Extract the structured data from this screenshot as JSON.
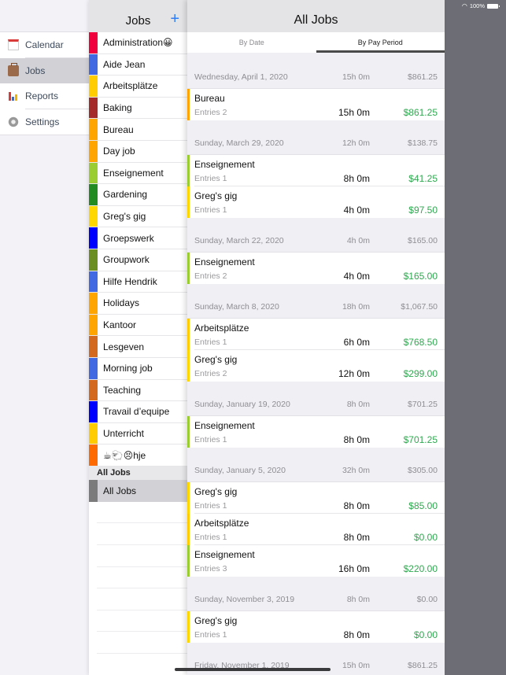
{
  "status_bar": {
    "battery": "100%",
    "wifi_icon": "wifi-icon",
    "battery_icon": "battery-icon"
  },
  "sidebar": {
    "items": [
      {
        "label": "Calendar",
        "icon": "calendar-icon",
        "selected": false
      },
      {
        "label": "Jobs",
        "icon": "briefcase-icon",
        "selected": true
      },
      {
        "label": "Reports",
        "icon": "bar-chart-icon",
        "selected": false
      },
      {
        "label": "Settings",
        "icon": "gear-icon",
        "selected": false
      }
    ]
  },
  "jobs_panel": {
    "title": "Jobs",
    "add_icon": "+",
    "jobs": [
      {
        "name": "Administration😀",
        "color": "#f0003c"
      },
      {
        "name": "Aide Jean",
        "color": "#4169e1"
      },
      {
        "name": "Arbeitsplätze",
        "color": "#ffcc00"
      },
      {
        "name": "Baking",
        "color": "#a52a2a"
      },
      {
        "name": "Bureau",
        "color": "#ffa500"
      },
      {
        "name": "Day job",
        "color": "#ffa500"
      },
      {
        "name": "Enseignement",
        "color": "#9acd32"
      },
      {
        "name": "Gardening",
        "color": "#228b22"
      },
      {
        "name": "Greg's gig",
        "color": "#ffd700"
      },
      {
        "name": "Groepswerk",
        "color": "#0000ff"
      },
      {
        "name": "Groupwork",
        "color": "#6b8e23"
      },
      {
        "name": "Hilfe Hendrik",
        "color": "#4169e1"
      },
      {
        "name": "Holidays",
        "color": "#ffa500"
      },
      {
        "name": "Kantoor",
        "color": "#ffa500"
      },
      {
        "name": "Lesgeven",
        "color": "#d2691e"
      },
      {
        "name": "Morning job",
        "color": "#4169e1"
      },
      {
        "name": "Teaching",
        "color": "#d2691e"
      },
      {
        "name": "Travail d’equipe",
        "color": "#0000ff"
      },
      {
        "name": "Unterricht",
        "color": "#ffcc00"
      },
      {
        "name": "☕🐑😣hje",
        "color": "#ff6a00"
      }
    ],
    "section_header": "All Jobs",
    "all_jobs_label": "All Jobs",
    "all_jobs_color": "#7b7b7b"
  },
  "main": {
    "title": "All Jobs",
    "tabs": [
      {
        "label": "By Date",
        "active": false
      },
      {
        "label": "By Pay Period",
        "active": true
      }
    ],
    "groups": [
      {
        "date": "Wednesday, April 1, 2020",
        "hours": "15h 0m",
        "amount": "$861.25",
        "entries": [
          {
            "job": "Bureau",
            "entries": "Entries 2",
            "hours": "15h 0m",
            "amount": "$861.25",
            "color": "#ffa500"
          }
        ]
      },
      {
        "date": "Sunday, March 29, 2020",
        "hours": "12h 0m",
        "amount": "$138.75",
        "entries": [
          {
            "job": "Enseignement",
            "entries": "Entries 1",
            "hours": "8h 0m",
            "amount": "$41.25",
            "color": "#9acd32"
          },
          {
            "job": "Greg's gig",
            "entries": "Entries 1",
            "hours": "4h 0m",
            "amount": "$97.50",
            "color": "#ffd700"
          }
        ]
      },
      {
        "date": "Sunday, March 22, 2020",
        "hours": "4h 0m",
        "amount": "$165.00",
        "entries": [
          {
            "job": "Enseignement",
            "entries": "Entries 2",
            "hours": "4h 0m",
            "amount": "$165.00",
            "color": "#9acd32"
          }
        ]
      },
      {
        "date": "Sunday, March 8, 2020",
        "hours": "18h 0m",
        "amount": "$1,067.50",
        "entries": [
          {
            "job": "Arbeitsplätze",
            "entries": "Entries 1",
            "hours": "6h 0m",
            "amount": "$768.50",
            "color": "#ffcc00"
          },
          {
            "job": "Greg's gig",
            "entries": "Entries 2",
            "hours": "12h 0m",
            "amount": "$299.00",
            "color": "#ffd700"
          }
        ]
      },
      {
        "date": "Sunday, January 19, 2020",
        "hours": "8h 0m",
        "amount": "$701.25",
        "entries": [
          {
            "job": "Enseignement",
            "entries": "Entries 1",
            "hours": "8h 0m",
            "amount": "$701.25",
            "color": "#9acd32"
          }
        ]
      },
      {
        "date": "Sunday, January 5, 2020",
        "hours": "32h 0m",
        "amount": "$305.00",
        "entries": [
          {
            "job": "Greg's gig",
            "entries": "Entries 1",
            "hours": "8h 0m",
            "amount": "$85.00",
            "color": "#ffd700"
          },
          {
            "job": "Arbeitsplätze",
            "entries": "Entries 1",
            "hours": "8h 0m",
            "amount": "$0.00",
            "color": "#ffcc00"
          },
          {
            "job": "Enseignement",
            "entries": "Entries 3",
            "hours": "16h 0m",
            "amount": "$220.00",
            "color": "#9acd32"
          }
        ]
      },
      {
        "date": "Sunday, November 3, 2019",
        "hours": "8h 0m",
        "amount": "$0.00",
        "entries": [
          {
            "job": "Greg's gig",
            "entries": "Entries 1",
            "hours": "8h 0m",
            "amount": "$0.00",
            "color": "#ffd700"
          }
        ]
      },
      {
        "date": "Friday, November 1, 2019",
        "hours": "15h 0m",
        "amount": "$861.25",
        "entries": []
      }
    ]
  }
}
